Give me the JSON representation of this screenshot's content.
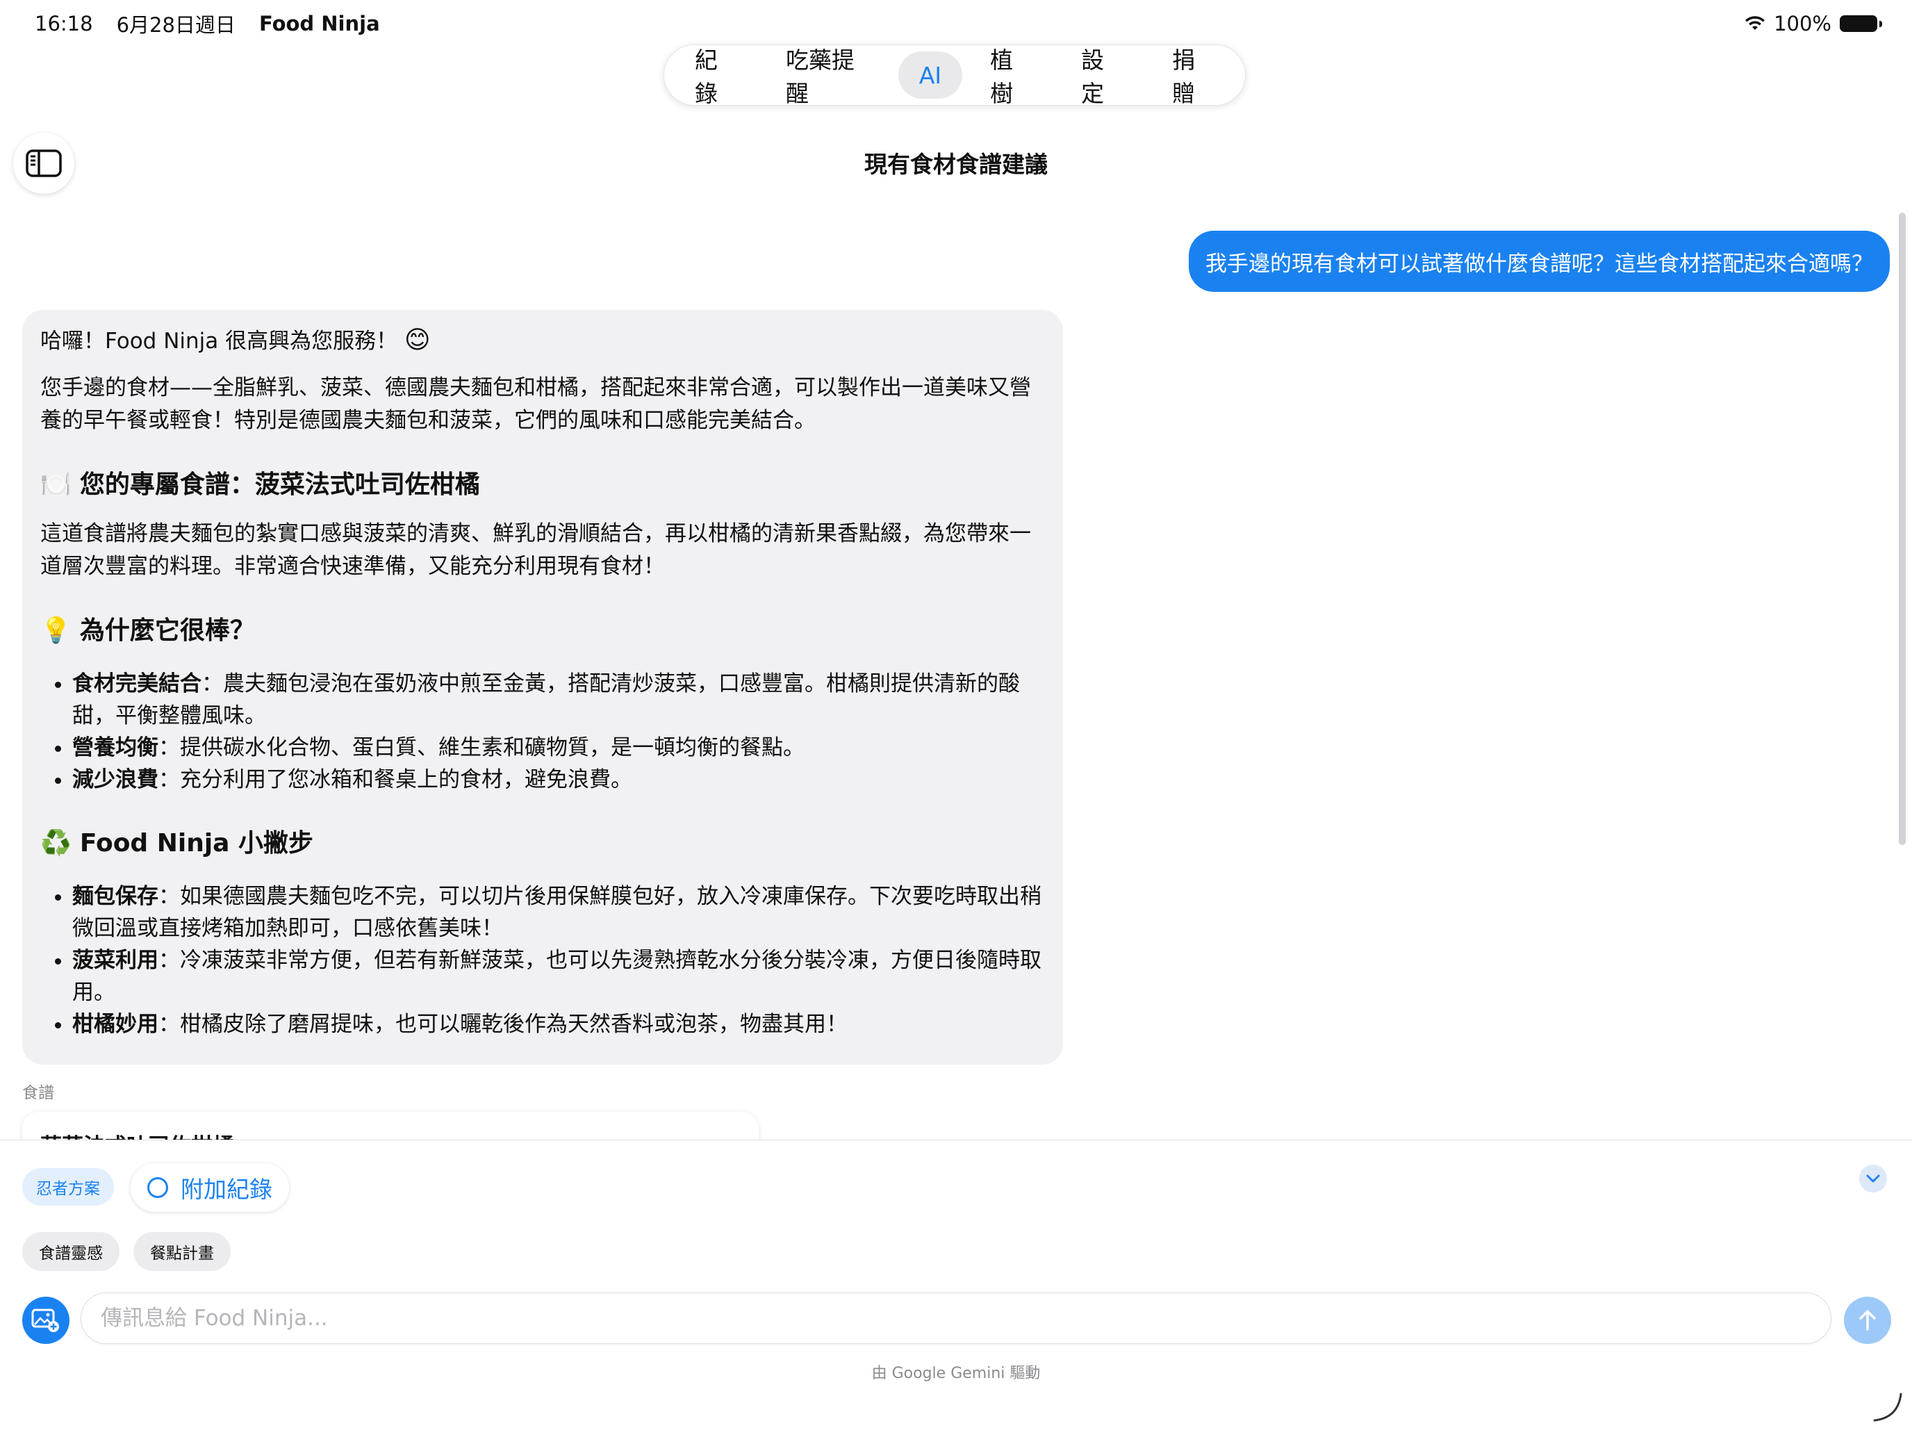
{
  "status_bar": {
    "time": "16:18",
    "date": "6月28日週日",
    "app_name": "Food Ninja",
    "battery": "100%",
    "wifi_icon": "wifi-icon",
    "battery_icon": "battery-icon"
  },
  "tabs": [
    {
      "label": "紀錄",
      "active": false
    },
    {
      "label": "吃藥提醒",
      "active": false
    },
    {
      "label": "AI",
      "active": true
    },
    {
      "label": "植樹",
      "active": false
    },
    {
      "label": "設定",
      "active": false
    },
    {
      "label": "捐贈",
      "active": false
    }
  ],
  "page_title": "現有食材食譜建議",
  "user_message": "我手邊的現有食材可以試著做什麼食譜呢？這些食材搭配起來合適嗎？",
  "ai_message": {
    "greeting": "哈囉！Food Ninja 很高興為您服務！",
    "greeting_emoji": "😊",
    "intro": "您手邊的食材——全脂鮮乳、菠菜、德國農夫麵包和柑橘，搭配起來非常合適，可以製作出一道美味又營養的早午餐或輕食！特別是德國農夫麵包和菠菜，它們的風味和口感能完美結合。",
    "recipe_emoji": "🍽️",
    "recipe_heading": "您的專屬食譜：菠菜法式吐司佐柑橘",
    "recipe_desc": "這道食譜將農夫麵包的紮實口感與菠菜的清爽、鮮乳的滑順結合，再以柑橘的清新果香點綴，為您帶來一道層次豐富的料理。非常適合快速準備，又能充分利用現有食材！",
    "why_emoji": "💡",
    "why_heading": "為什麼它很棒？",
    "why_items": [
      {
        "title": "食材完美結合",
        "text": "：農夫麵包浸泡在蛋奶液中煎至金黃，搭配清炒菠菜，口感豐富。柑橘則提供清新的酸甜，平衡整體風味。"
      },
      {
        "title": "營養均衡",
        "text": "：提供碳水化合物、蛋白質、維生素和礦物質，是一頓均衡的餐點。"
      },
      {
        "title": "減少浪費",
        "text": "：充分利用了您冰箱和餐桌上的食材，避免浪費。"
      }
    ],
    "tips_emoji": "♻️",
    "tips_heading": "Food Ninja 小撇步",
    "tips_items": [
      {
        "title": "麵包保存",
        "text": "：如果德國農夫麵包吃不完，可以切片後用保鮮膜包好，放入冷凍庫保存。下次要吃時取出稍微回溫或直接烤箱加熱即可，口感依舊美味！"
      },
      {
        "title": "菠菜利用",
        "text": "：冷凍菠菜非常方便，但若有新鮮菠菜，也可以先燙熟擠乾水分後分裝冷凍，方便日後隨時取用。"
      },
      {
        "title": "柑橘妙用",
        "text": "：柑橘皮除了磨屑提味，也可以曬乾後作為天然香料或泡茶，物盡其用！"
      }
    ]
  },
  "recipe_section_label": "食譜",
  "recipe_card_title": "菠菜法式吐司佐柑橘",
  "chips": {
    "ninja_plan": "忍者方案",
    "attach_record": "附加紀錄",
    "recipe_inspiration": "食譜靈感",
    "meal_plan": "餐點計畫"
  },
  "input": {
    "placeholder": "傳訊息給 Food Ninja...",
    "value": ""
  },
  "powered_by": "由 Google Gemini 驅動",
  "colors": {
    "accent": "#1a82f0",
    "bubble_gray": "#f1f1f4",
    "send_disabled": "#9cc9f7"
  }
}
